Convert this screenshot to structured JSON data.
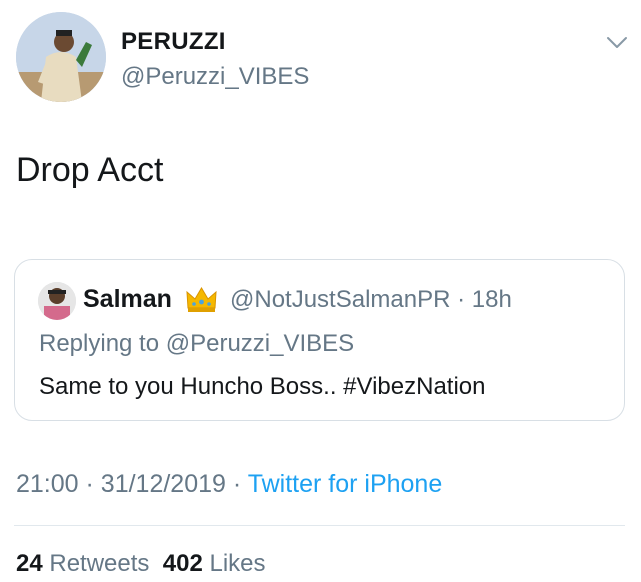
{
  "author": {
    "display_name": "PERUZZI",
    "handle": "@Peruzzi_VIBES",
    "avatar_icon": "profile-photo-avatar"
  },
  "tweet": {
    "text": "Drop Acct",
    "time": "21:00",
    "date": "31/12/2019",
    "separator": "·",
    "source": "Twitter for iPhone"
  },
  "quoted_tweet": {
    "display_name": "Salman",
    "crown_icon": "crown-emoji-icon",
    "handle": "@NotJustSalmanPR",
    "separator": "·",
    "age": "18h",
    "replying_prefix": "Replying to",
    "replying_handle": "@Peruzzi_VIBES",
    "text": "Same to you Huncho Boss.. #VibezNation"
  },
  "stats": {
    "retweets_count": "24",
    "retweets_label": "Retweets",
    "likes_count": "402",
    "likes_label": "Likes"
  },
  "colors": {
    "link_blue": "#1da1f2",
    "secondary_text": "#657786",
    "border": "#d8dfe5"
  }
}
